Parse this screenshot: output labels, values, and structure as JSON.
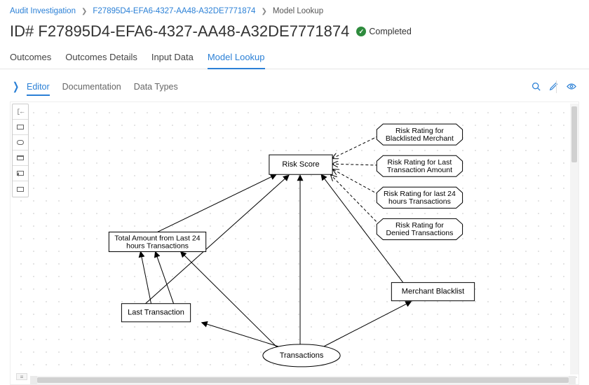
{
  "breadcrumb": {
    "root": "Audit Investigation",
    "mid": "F27895D4-EFA6-4327-AA48-A32DE7771874",
    "leaf": "Model Lookup"
  },
  "title": {
    "prefix": "ID#",
    "id": "F27895D4-EFA6-4327-AA48-A32DE7771874"
  },
  "status": {
    "label": "Completed"
  },
  "tabs": {
    "outcomes": "Outcomes",
    "outcomes_details": "Outcomes Details",
    "input_data": "Input Data",
    "model_lookup": "Model Lookup"
  },
  "subtabs": {
    "editor": "Editor",
    "documentation": "Documentation",
    "data_types": "Data Types"
  },
  "nodes": {
    "risk_score": "Risk Score",
    "total_amount_l1": "Total Amount from Last 24",
    "total_amount_l2": "hours Transactions",
    "last_transaction": "Last Transaction",
    "transactions": "Transactions",
    "merchant_blacklist": "Merchant Blacklist",
    "bkt1_l1": "Risk Rating for",
    "bkt1_l2": "Blacklisted Merchant",
    "bkt2_l1": "Risk Rating for Last",
    "bkt2_l2": "Transaction Amount",
    "bkt3_l1": "Risk Rating for last 24",
    "bkt3_l2": "hours Transactions",
    "bkt4_l1": "Risk Rating for",
    "bkt4_l2": "Denied Transactions"
  }
}
